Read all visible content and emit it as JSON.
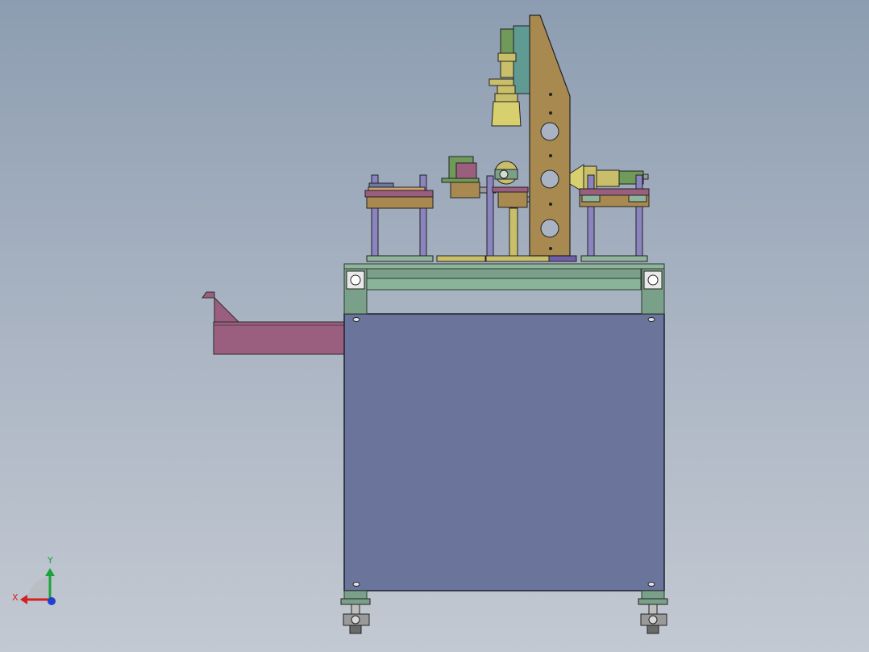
{
  "viewport": {
    "background_top": "#8d9db1",
    "background_bottom": "#c3c9d2"
  },
  "triad": {
    "x_label": "X",
    "y_label": "Y",
    "x_color": "#d42020",
    "y_color": "#1aa33a",
    "z_color": "#2040d0"
  },
  "colors": {
    "cabinet_panel": "#6b759c",
    "frame_green": "#7aa08a",
    "upright_plate": "#a8894f",
    "tray": "#9a5f7e",
    "rods": "#8a84c0",
    "brass": "#c9bf6a",
    "olive_motor": "#6f9a5a"
  }
}
